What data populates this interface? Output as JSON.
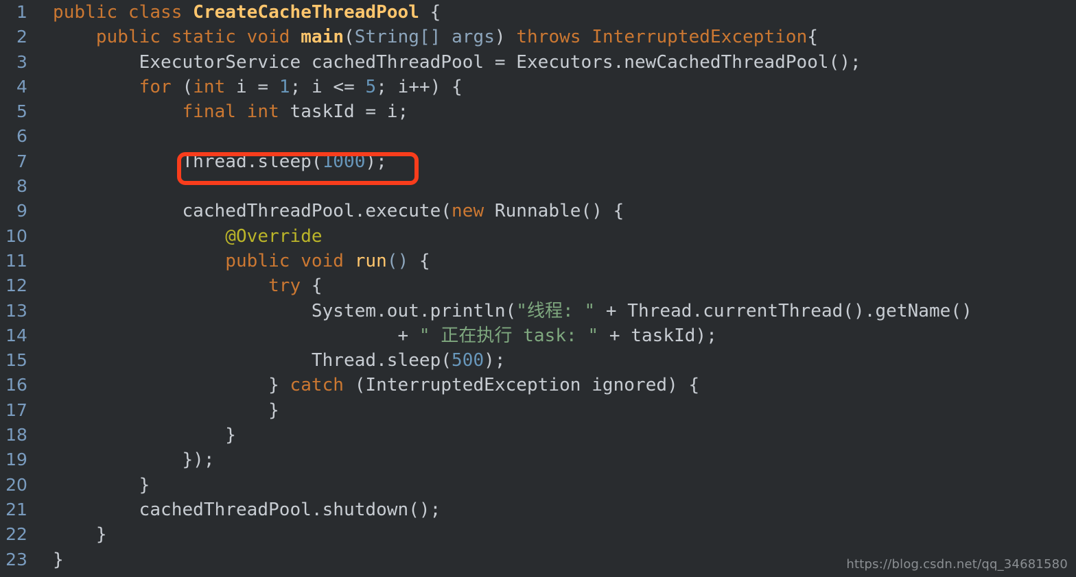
{
  "editor": {
    "background_color": "#292c2f",
    "language": "java",
    "total_lines": 23
  },
  "theme": {
    "keyword_color": "#cc7832",
    "class_name_color": "#ffc66d",
    "parameter_color": "#8da6bd",
    "number_color": "#6897bb",
    "string_color": "#7fa87f",
    "annotation_color": "#bbb529",
    "plain_text_color": "#c8cdd3",
    "line_number_color": "#7a9cbf",
    "highlight_box_color": "#f93d1c"
  },
  "annotation": {
    "type": "rounded-rectangle-highlight",
    "target_line": 7,
    "target_text": "Thread.sleep(1000);"
  },
  "watermark": {
    "text": "https://blog.csdn.net/qq_34681580"
  },
  "lines": [
    {
      "number": "1",
      "tokens": [
        {
          "t": "public class ",
          "c": "kw"
        },
        {
          "t": "CreateCacheThreadPool",
          "c": "cls"
        },
        {
          "t": " {",
          "c": "pl"
        }
      ]
    },
    {
      "number": "2",
      "tokens": [
        {
          "t": "    ",
          "c": "pl"
        },
        {
          "t": "public static void ",
          "c": "kw"
        },
        {
          "t": "main",
          "c": "cls"
        },
        {
          "t": "(",
          "c": "pl"
        },
        {
          "t": "String[] args",
          "c": "par"
        },
        {
          "t": ") ",
          "c": "pl"
        },
        {
          "t": "throws InterruptedException",
          "c": "kw"
        },
        {
          "t": "{",
          "c": "pl"
        }
      ]
    },
    {
      "number": "3",
      "tokens": [
        {
          "t": "        ExecutorService cachedThreadPool = Executors.newCachedThreadPool();",
          "c": "pl"
        }
      ]
    },
    {
      "number": "4",
      "tokens": [
        {
          "t": "        ",
          "c": "pl"
        },
        {
          "t": "for",
          "c": "kw"
        },
        {
          "t": " (",
          "c": "pl"
        },
        {
          "t": "int",
          "c": "kw"
        },
        {
          "t": " i = ",
          "c": "pl"
        },
        {
          "t": "1",
          "c": "num"
        },
        {
          "t": "; i <= ",
          "c": "pl"
        },
        {
          "t": "5",
          "c": "num"
        },
        {
          "t": "; i++) {",
          "c": "pl"
        }
      ]
    },
    {
      "number": "5",
      "tokens": [
        {
          "t": "            ",
          "c": "pl"
        },
        {
          "t": "final int",
          "c": "kw"
        },
        {
          "t": " taskId = i;",
          "c": "pl"
        }
      ]
    },
    {
      "number": "6",
      "tokens": [
        {
          "t": "",
          "c": "pl"
        }
      ]
    },
    {
      "number": "7",
      "tokens": [
        {
          "t": "            Thread.sleep(",
          "c": "pl"
        },
        {
          "t": "1000",
          "c": "num"
        },
        {
          "t": ");",
          "c": "pl"
        }
      ]
    },
    {
      "number": "8",
      "tokens": [
        {
          "t": "",
          "c": "pl"
        }
      ]
    },
    {
      "number": "9",
      "tokens": [
        {
          "t": "            cachedThreadPool.execute(",
          "c": "pl"
        },
        {
          "t": "new",
          "c": "kw"
        },
        {
          "t": " Runnable() {",
          "c": "pl"
        }
      ]
    },
    {
      "number": "10",
      "tokens": [
        {
          "t": "                ",
          "c": "pl"
        },
        {
          "t": "@Override",
          "c": "ann"
        }
      ]
    },
    {
      "number": "11",
      "tokens": [
        {
          "t": "                ",
          "c": "pl"
        },
        {
          "t": "public void ",
          "c": "kw"
        },
        {
          "t": "run",
          "c": "mth"
        },
        {
          "t": "(",
          "c": "par"
        },
        {
          "t": ")",
          "c": "par"
        },
        {
          "t": " {",
          "c": "pl"
        }
      ]
    },
    {
      "number": "12",
      "tokens": [
        {
          "t": "                    ",
          "c": "pl"
        },
        {
          "t": "try",
          "c": "kw"
        },
        {
          "t": " {",
          "c": "pl"
        }
      ]
    },
    {
      "number": "13",
      "tokens": [
        {
          "t": "                        System.out.println(",
          "c": "pl"
        },
        {
          "t": "\"线程: \"",
          "c": "str"
        },
        {
          "t": " + Thread.currentThread().getName()",
          "c": "pl"
        }
      ]
    },
    {
      "number": "14",
      "tokens": [
        {
          "t": "                                + ",
          "c": "pl"
        },
        {
          "t": "\" 正在执行 task: \"",
          "c": "str"
        },
        {
          "t": " + taskId);",
          "c": "pl"
        }
      ]
    },
    {
      "number": "15",
      "tokens": [
        {
          "t": "                        Thread.sleep(",
          "c": "pl"
        },
        {
          "t": "500",
          "c": "num"
        },
        {
          "t": ");",
          "c": "pl"
        }
      ]
    },
    {
      "number": "16",
      "tokens": [
        {
          "t": "                    } ",
          "c": "pl"
        },
        {
          "t": "catch",
          "c": "kw"
        },
        {
          "t": " (InterruptedException ignored) {",
          "c": "pl"
        }
      ]
    },
    {
      "number": "17",
      "tokens": [
        {
          "t": "                    }",
          "c": "pl"
        }
      ]
    },
    {
      "number": "18",
      "tokens": [
        {
          "t": "                }",
          "c": "pl"
        }
      ]
    },
    {
      "number": "19",
      "tokens": [
        {
          "t": "            });",
          "c": "pl"
        }
      ]
    },
    {
      "number": "20",
      "tokens": [
        {
          "t": "        }",
          "c": "pl"
        }
      ]
    },
    {
      "number": "21",
      "tokens": [
        {
          "t": "        cachedThreadPool.shutdown();",
          "c": "pl"
        }
      ]
    },
    {
      "number": "22",
      "tokens": [
        {
          "t": "    }",
          "c": "pl"
        }
      ]
    },
    {
      "number": "23",
      "tokens": [
        {
          "t": "}",
          "c": "pl"
        }
      ]
    }
  ]
}
